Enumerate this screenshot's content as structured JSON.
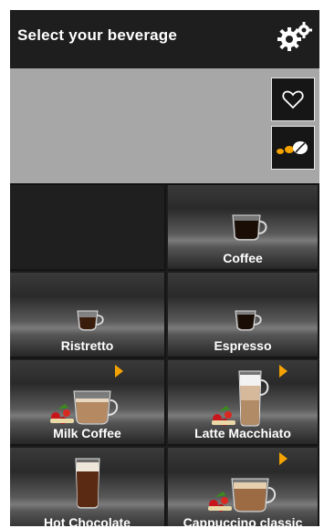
{
  "header": {
    "title": "Select your beverage",
    "settings_icon": "gears-icon"
  },
  "side_buttons": [
    {
      "icon": "heart-icon"
    },
    {
      "icon": "coffee-beans-icon"
    }
  ],
  "beverages": [
    {
      "label": "Coffee",
      "has_options": false
    },
    {
      "label": "Ristretto",
      "has_options": false
    },
    {
      "label": "Espresso",
      "has_options": false
    },
    {
      "label": "Milk Coffee",
      "has_options": true
    },
    {
      "label": "Latte Macchiato",
      "has_options": true
    },
    {
      "label": "Hot Chocolate",
      "has_options": false
    },
    {
      "label": "Cappuccino classic",
      "has_options": true
    }
  ],
  "colors": {
    "accent": "#f5a300",
    "background": "#1d1d1d",
    "grey_area": "#a7a7a7"
  }
}
